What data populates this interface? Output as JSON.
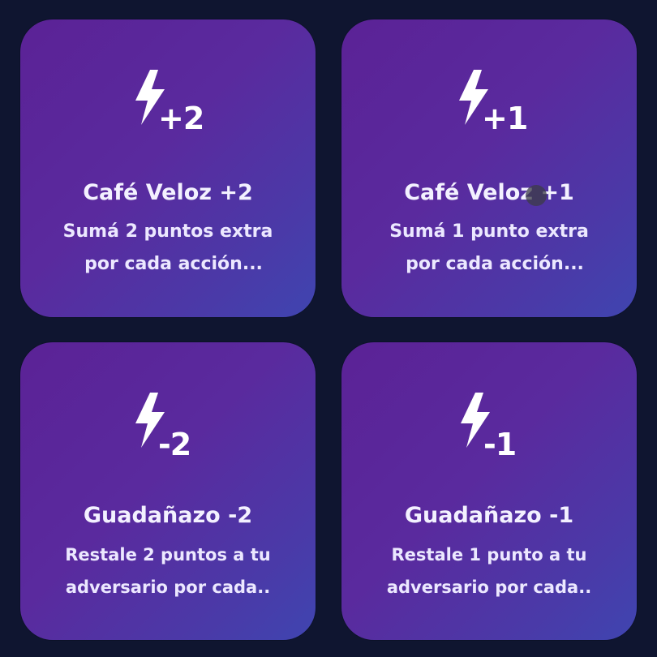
{
  "colors": {
    "background": "#0f1530",
    "card_gradient_start": "#5b2296",
    "card_gradient_end": "#3f45b0",
    "text": "#ffffff"
  },
  "cards": [
    {
      "icon": "lightning-bolt-icon",
      "modifier": "+2",
      "title": "Café Veloz +2",
      "desc_line1": "Sumá 2 puntos extra",
      "desc_line2": "por cada acción..."
    },
    {
      "icon": "lightning-bolt-icon",
      "modifier": "+1",
      "title": "Café Veloz +1",
      "desc_line1": "Sumá 1 punto extra",
      "desc_line2": "por cada acción..."
    },
    {
      "icon": "lightning-bolt-icon",
      "modifier": "-2",
      "title": "Guadañazo -2",
      "desc_line1": "Restale 2 puntos a tu",
      "desc_line2": "adversario por cada.."
    },
    {
      "icon": "lightning-bolt-icon",
      "modifier": "-1",
      "title": "Guadañazo -1",
      "desc_line1": "Restale 1 punto a tu",
      "desc_line2": "adversario por cada.."
    }
  ]
}
